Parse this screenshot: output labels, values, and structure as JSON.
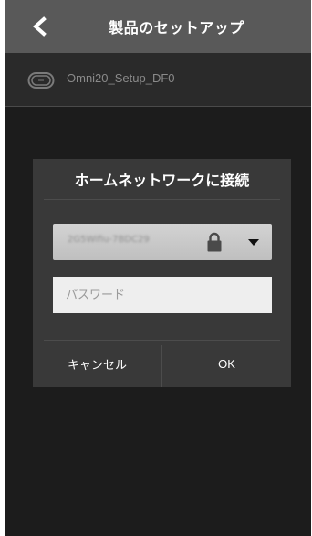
{
  "header": {
    "title": "製品のセットアップ",
    "back_icon": "chevron-left-icon"
  },
  "device": {
    "name": "Omni20_Setup_DF0",
    "icon": "device-pill-icon"
  },
  "dialog": {
    "title": "ホームネットワークに接続",
    "network": {
      "selected_ssid": "2G5Wifiu-7BDC29",
      "lock_icon": "lock-icon",
      "dropdown_icon": "caret-down-icon"
    },
    "password": {
      "value": "",
      "placeholder": "パスワード"
    },
    "cancel_label": "キャンセル",
    "ok_label": "OK"
  },
  "colors": {
    "titlebar": "#595959",
    "background": "#2a2a2a",
    "dialog": "#393939",
    "select": "#c9c9c9",
    "input": "#eeeeee"
  }
}
